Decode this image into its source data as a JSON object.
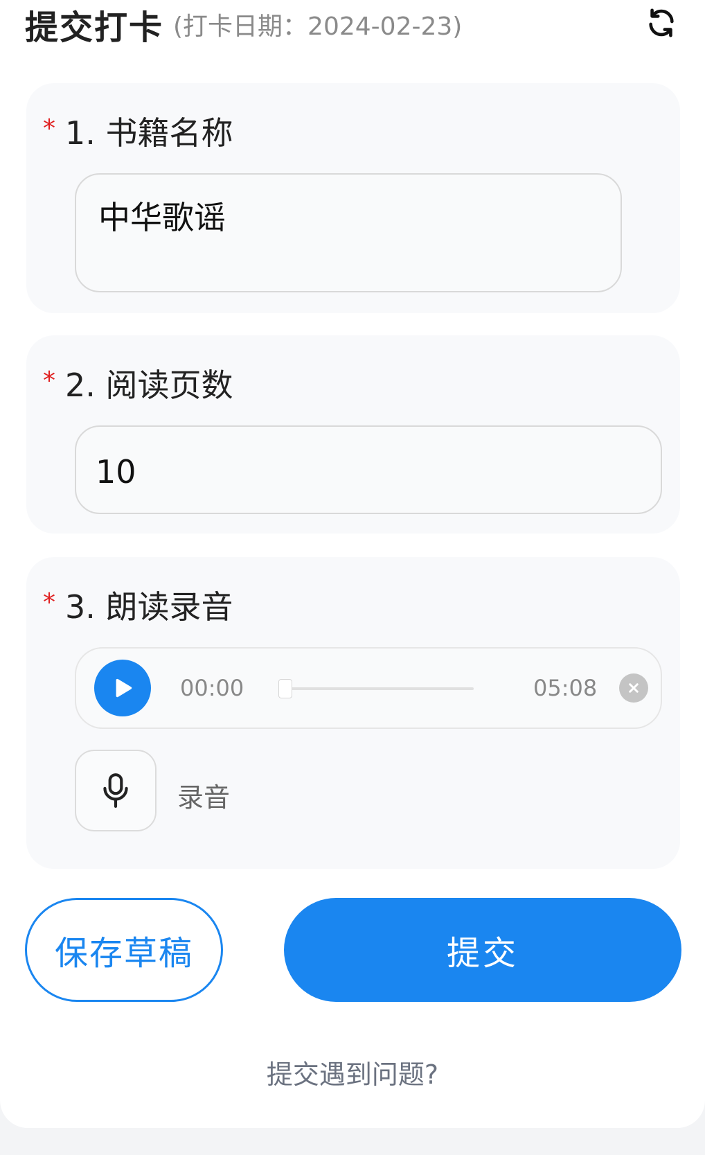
{
  "header": {
    "title": "提交打卡",
    "subtitle": "(打卡日期：2024-02-23)"
  },
  "questions": [
    {
      "star": "*",
      "label": "1. 书籍名称",
      "value": "中华歌谣"
    },
    {
      "star": "*",
      "label": "2. 阅读页数",
      "value": "10"
    },
    {
      "star": "*",
      "label": "3. 朗读录音"
    }
  ],
  "audio": {
    "current_time": "00:00",
    "duration": "05:08",
    "progress": 0
  },
  "record": {
    "label": "录音"
  },
  "buttons": {
    "save_draft": "保存草稿",
    "submit": "提交"
  },
  "help_link": "提交遇到问题?",
  "colors": {
    "accent": "#1a86f0",
    "required": "#e02020"
  },
  "icons": {
    "refresh": "refresh-icon",
    "play": "play-icon",
    "close": "close-icon",
    "mic": "microphone-icon"
  }
}
